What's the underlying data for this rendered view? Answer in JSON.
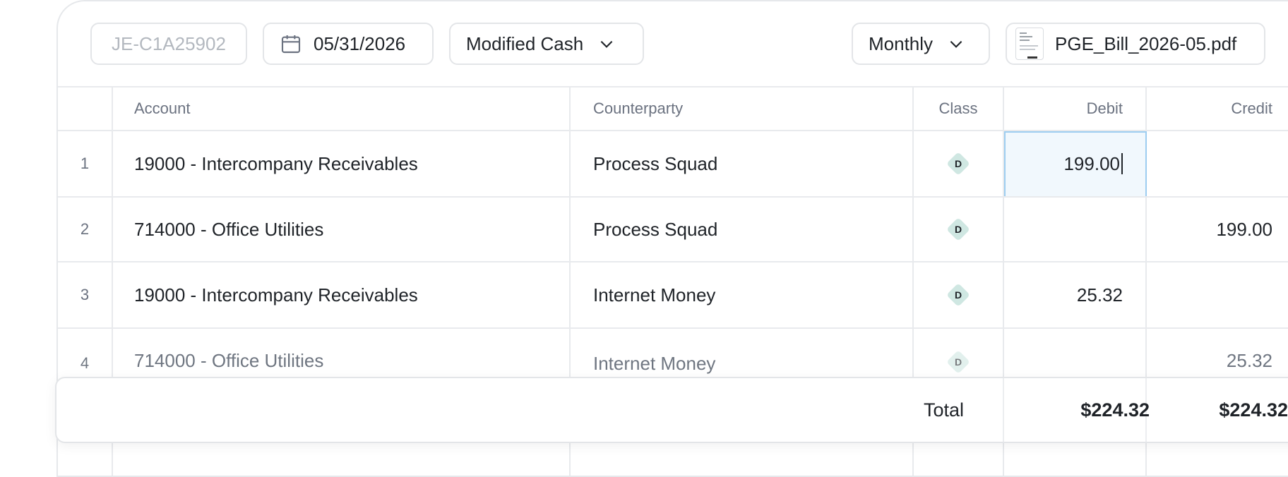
{
  "toolbar": {
    "entry_id_placeholder": "JE-C1A25902",
    "date": "05/31/2026",
    "basis": "Modified Cash",
    "frequency": "Monthly",
    "attachment": "PGE_Bill_2026-05.pdf"
  },
  "columns": {
    "account": "Account",
    "counterparty": "Counterparty",
    "class": "Class",
    "debit": "Debit",
    "credit": "Credit"
  },
  "rows": [
    {
      "num": "1",
      "account": "19000 - Intercompany Receivables",
      "counterparty": "Process Squad",
      "class": "D",
      "debit": "199.00",
      "credit": ""
    },
    {
      "num": "2",
      "account": "714000 - Office Utilities",
      "counterparty": "Process Squad",
      "class": "D",
      "debit": "",
      "credit": "199.00"
    },
    {
      "num": "3",
      "account": "19000 - Intercompany Receivables",
      "counterparty": "Internet Money",
      "class": "D",
      "debit": "25.32",
      "credit": ""
    },
    {
      "num": "4",
      "account": "714000 - Office Utilities",
      "counterparty": "Internet Money",
      "class": "D",
      "debit": "",
      "credit": "25.32"
    }
  ],
  "totals": {
    "label": "Total",
    "debit": "$224.32",
    "credit": "$224.32"
  },
  "colors": {
    "class_badge": "#cfe7e2",
    "edit_border": "#9dcdf0",
    "edit_fill": "#f1f8fd"
  }
}
